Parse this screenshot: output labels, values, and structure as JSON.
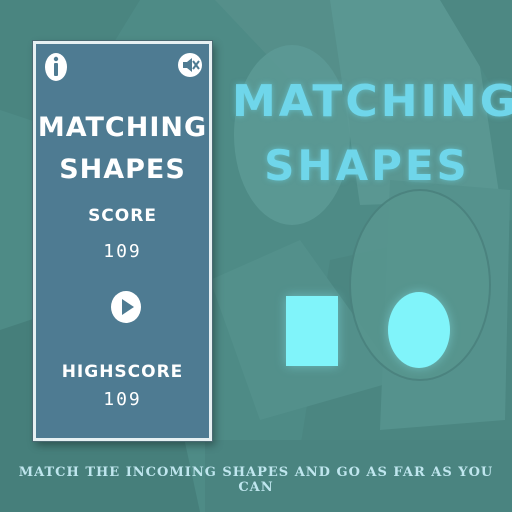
{
  "panel": {
    "title_line1": "MATCHING",
    "title_line2": "SHAPES",
    "score_label": "SCORE",
    "score_value": "109",
    "highscore_label": "HIGHSCORE",
    "highscore_value": "109",
    "info_icon": "info-icon",
    "sound_icon": "sound-muted-icon",
    "play_icon": "play-icon"
  },
  "main": {
    "title_line1": "MATCHING",
    "title_line2": "SHAPES"
  },
  "shapes": [
    "square",
    "circle"
  ],
  "tagline": "MATCH THE INCOMING SHAPES AND GO AS FAR AS YOU CAN",
  "colors": {
    "background": "#4e8b86",
    "panel": "#4e7b92",
    "accent": "#6fd6ea",
    "shape": "#80f4fa"
  }
}
